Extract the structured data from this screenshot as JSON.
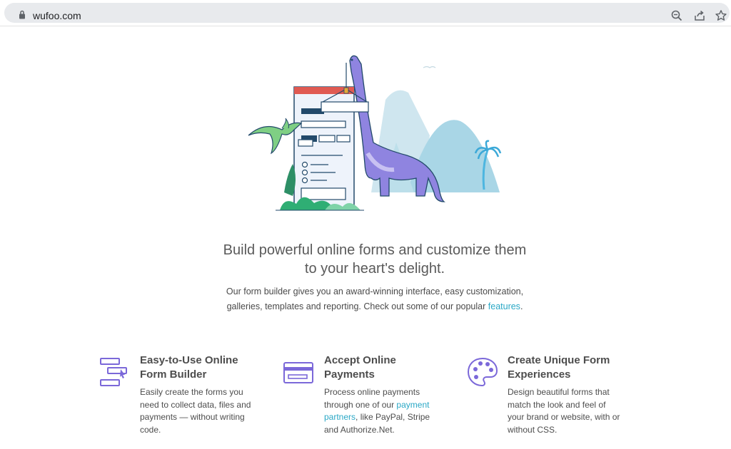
{
  "browser": {
    "url": "wufoo.com",
    "icons": [
      "lock-icon",
      "zoom-icon",
      "share-icon",
      "bookmark-star-icon"
    ]
  },
  "hero": {
    "headline_line1": "Build powerful online forms and customize them",
    "headline_line2": "to your heart's delight.",
    "sub_line1": "Our form builder gives you an award-winning interface, easy customization,",
    "sub_line2_start": "galleries, templates and reporting. Check out some of our popular ",
    "sub_link": "features",
    "sub_line2_end": "."
  },
  "features": [
    {
      "icon": "form-builder-icon",
      "title_line1": "Easy-to-Use Online",
      "title_line2": "Form Builder",
      "desc_lines": [
        "Easily create the forms you",
        "need to collect data, files and",
        "payments — without writing",
        "code."
      ]
    },
    {
      "icon": "payment-card-icon",
      "title_line1": "Accept Online",
      "title_line2": "Payments",
      "desc_line1": "Process online payments",
      "desc_line2_start": "through one of our ",
      "desc_link_part1": "payment",
      "desc_link_part2": "partners",
      "desc_line3_rest": ", like PayPal, Stripe",
      "desc_line4": "and Authorize.Net."
    },
    {
      "icon": "palette-icon",
      "title_line1": "Create Unique Form",
      "title_line2": "Experiences",
      "desc_lines": [
        "Design beautiful forms that",
        "match the look and feel of",
        "your brand or website, with or",
        "without CSS."
      ]
    }
  ],
  "colors": {
    "accent_purple": "#7b68d9",
    "link": "#2aa8c6",
    "text": "#4d4d4d"
  }
}
